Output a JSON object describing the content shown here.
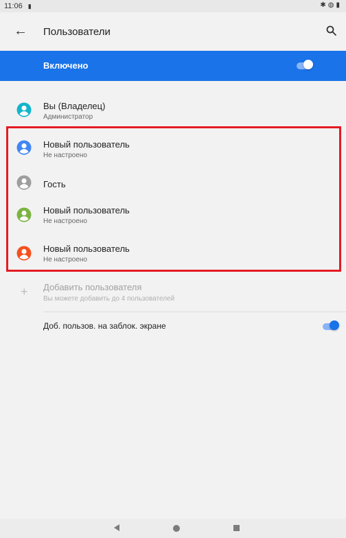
{
  "status_bar": {
    "time": "11:06",
    "left_icon": "sd-card-icon",
    "right_icons": [
      "bluetooth-icon",
      "vibrate-icon",
      "battery-icon"
    ]
  },
  "app_bar": {
    "back_icon": "arrow-back-icon",
    "title": "Пользователи",
    "search_icon": "search-icon"
  },
  "master_switch": {
    "label": "Включено",
    "checked": true,
    "color": "#1a73e8"
  },
  "owner": {
    "name": "Вы (Владелец)",
    "role": "Администратор",
    "avatar_color": "#12b5cb"
  },
  "users": [
    {
      "name": "Новый пользователь",
      "status": "Не настроено",
      "avatar_color": "#4285f4"
    },
    {
      "name": "Гость",
      "status": "",
      "avatar_color": "#9e9e9e"
    },
    {
      "name": "Новый пользователь",
      "status": "Не настроено",
      "avatar_color": "#7cb342"
    },
    {
      "name": "Новый пользователь",
      "status": "Не настроено",
      "avatar_color": "#f4511e"
    }
  ],
  "highlight_color": "#e31b23",
  "add_user": {
    "icon": "plus-icon",
    "label": "Добавить пользователя",
    "hint": "Вы можете добавить до 4 пользователей",
    "enabled": false
  },
  "lockscreen": {
    "label": "Доб. пользов. на заблок. экране",
    "checked": true
  },
  "nav_bar": {
    "icons": [
      "nav-back-icon",
      "nav-home-icon",
      "nav-recents-icon"
    ]
  }
}
